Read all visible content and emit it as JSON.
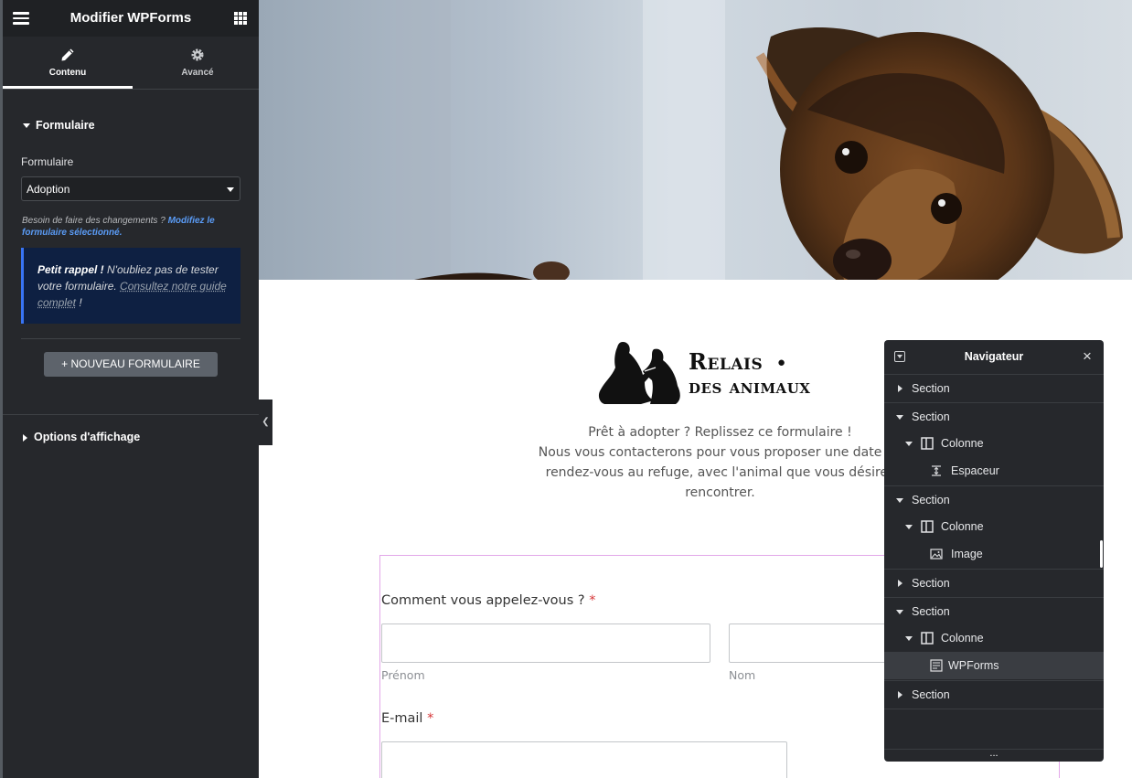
{
  "panel": {
    "title": "Modifier WPForms",
    "tabs": [
      {
        "label": "Contenu",
        "icon": "pencil-icon",
        "active": true
      },
      {
        "label": "Avancé",
        "icon": "gear-icon",
        "active": false
      }
    ],
    "section_form": "Formulaire",
    "field_label": "Formulaire",
    "select_value": "Adoption",
    "help_text": "Besoin de faire des changements ?",
    "help_link": "Modifiez le formulaire sélectionné.",
    "notice_bold": "Petit rappel !",
    "notice_text": "N'oubliez pas de tester votre formulaire.",
    "notice_link": "Consultez notre guide complet",
    "notice_end": "!",
    "new_button": "+ NOUVEAU FORMULAIRE",
    "section_display": "Options d'affichage",
    "colors": {
      "accent": "#3874f4",
      "link": "#5a9bf5",
      "panel_bg": "#26282c"
    }
  },
  "preview": {
    "logo_line1": "Relais",
    "logo_line2": "des animaux",
    "intro_line1": "Prêt à adopter ? Replissez ce formulaire !",
    "intro_line2": "Nous vous contacterons pour vous proposer une date de",
    "intro_line3": "rendez-vous au refuge, avec l'animal que vous désirez",
    "intro_line4": "rencontrer.",
    "name_question": "Comment vous appelez-vous ?",
    "required_mark": "*",
    "first_name_sublabel": "Prénom",
    "last_name_sublabel": "Nom",
    "email_question": "E-mail"
  },
  "navigator": {
    "title": "Navigateur",
    "close": "×",
    "more": "...",
    "items": [
      {
        "label": "Section",
        "type": "section",
        "expanded": false
      },
      {
        "label": "Section",
        "type": "section",
        "expanded": true
      },
      {
        "label": "Colonne",
        "type": "column",
        "expanded": true
      },
      {
        "label": "Espaceur",
        "type": "widget",
        "icon": "spacer-icon"
      },
      {
        "label": "Section",
        "type": "section",
        "expanded": true
      },
      {
        "label": "Colonne",
        "type": "column",
        "expanded": true
      },
      {
        "label": "Image",
        "type": "widget",
        "icon": "image-icon"
      },
      {
        "label": "Section",
        "type": "section",
        "expanded": false
      },
      {
        "label": "Section",
        "type": "section",
        "expanded": true
      },
      {
        "label": "Colonne",
        "type": "column",
        "expanded": true
      },
      {
        "label": "WPForms",
        "type": "widget",
        "icon": "form-icon",
        "selected": true
      },
      {
        "label": "Section",
        "type": "section",
        "expanded": false
      }
    ]
  }
}
